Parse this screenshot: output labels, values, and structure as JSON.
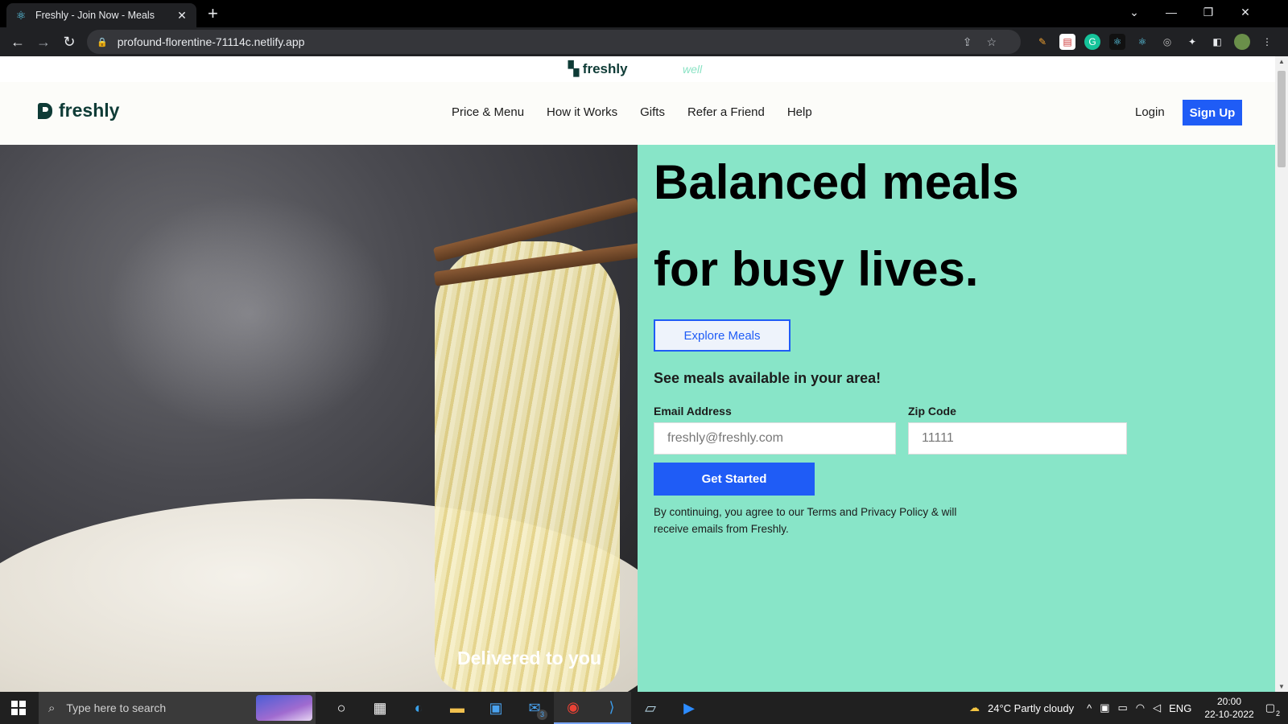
{
  "browser": {
    "tab_title": "Freshly - Join Now - Meals",
    "url": "profound-florentine-71114c.netlify.app"
  },
  "banner": {
    "logo": "freshly",
    "tagline": "well"
  },
  "nav": {
    "brand": "freshly",
    "menu": [
      "Price & Menu",
      "How it Works",
      "Gifts",
      "Refer a Friend",
      "Help"
    ],
    "login": "Login",
    "signup": "Sign Up"
  },
  "hero": {
    "headline_line1": "Balanced meals",
    "headline_line2": "for busy lives.",
    "explore_button": "Explore Meals",
    "subheading": "See meals available in your area!",
    "email_label": "Email Address",
    "email_placeholder": "freshly@freshly.com",
    "zip_label": "Zip Code",
    "zip_placeholder": "11111",
    "cta_button": "Get Started",
    "legal": "By continuing, you agree to our Terms and Privacy Policy & will receive emails from Freshly.",
    "image_caption": "Delivered to you"
  },
  "taskbar": {
    "search_placeholder": "Type here to search",
    "mail_badge": "3",
    "weather": "24°C  Partly cloudy",
    "language": "ENG",
    "time": "20:00",
    "date": "22-10-2022",
    "notification_count": "2"
  },
  "colors": {
    "brand_dark": "#0e3b36",
    "hero_green": "#88e5c8",
    "primary_blue": "#1f5cf6"
  }
}
